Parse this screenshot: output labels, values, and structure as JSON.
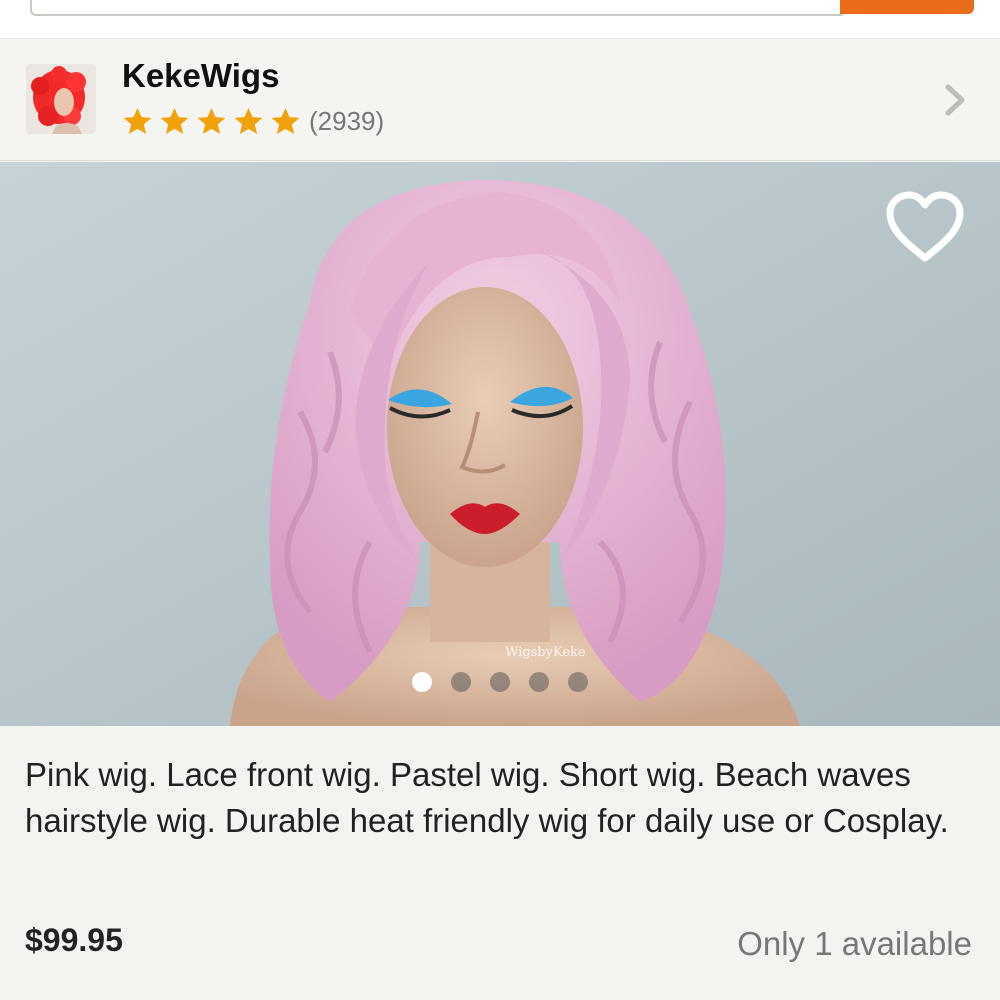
{
  "shop": {
    "name": "KekeWigs",
    "rating_stars": 5,
    "review_count": "(2939)"
  },
  "product": {
    "watermark": "WigsbyKeke",
    "image_count": 5,
    "active_image": 0,
    "title": "Pink wig. Lace front wig. Pastel wig. Short wig. Beach waves hairstyle wig. Durable heat friendly wig for daily use or Cosplay.",
    "price": "$99.95",
    "availability": "Only 1 available"
  },
  "icons": {
    "rating": "star-icon",
    "shop_link": "chevron-right-icon",
    "favorite": "heart-outline-icon"
  },
  "colors": {
    "accent": "#ea6c1a",
    "star": "#f1a20b",
    "text": "#222222",
    "muted": "#777777"
  }
}
